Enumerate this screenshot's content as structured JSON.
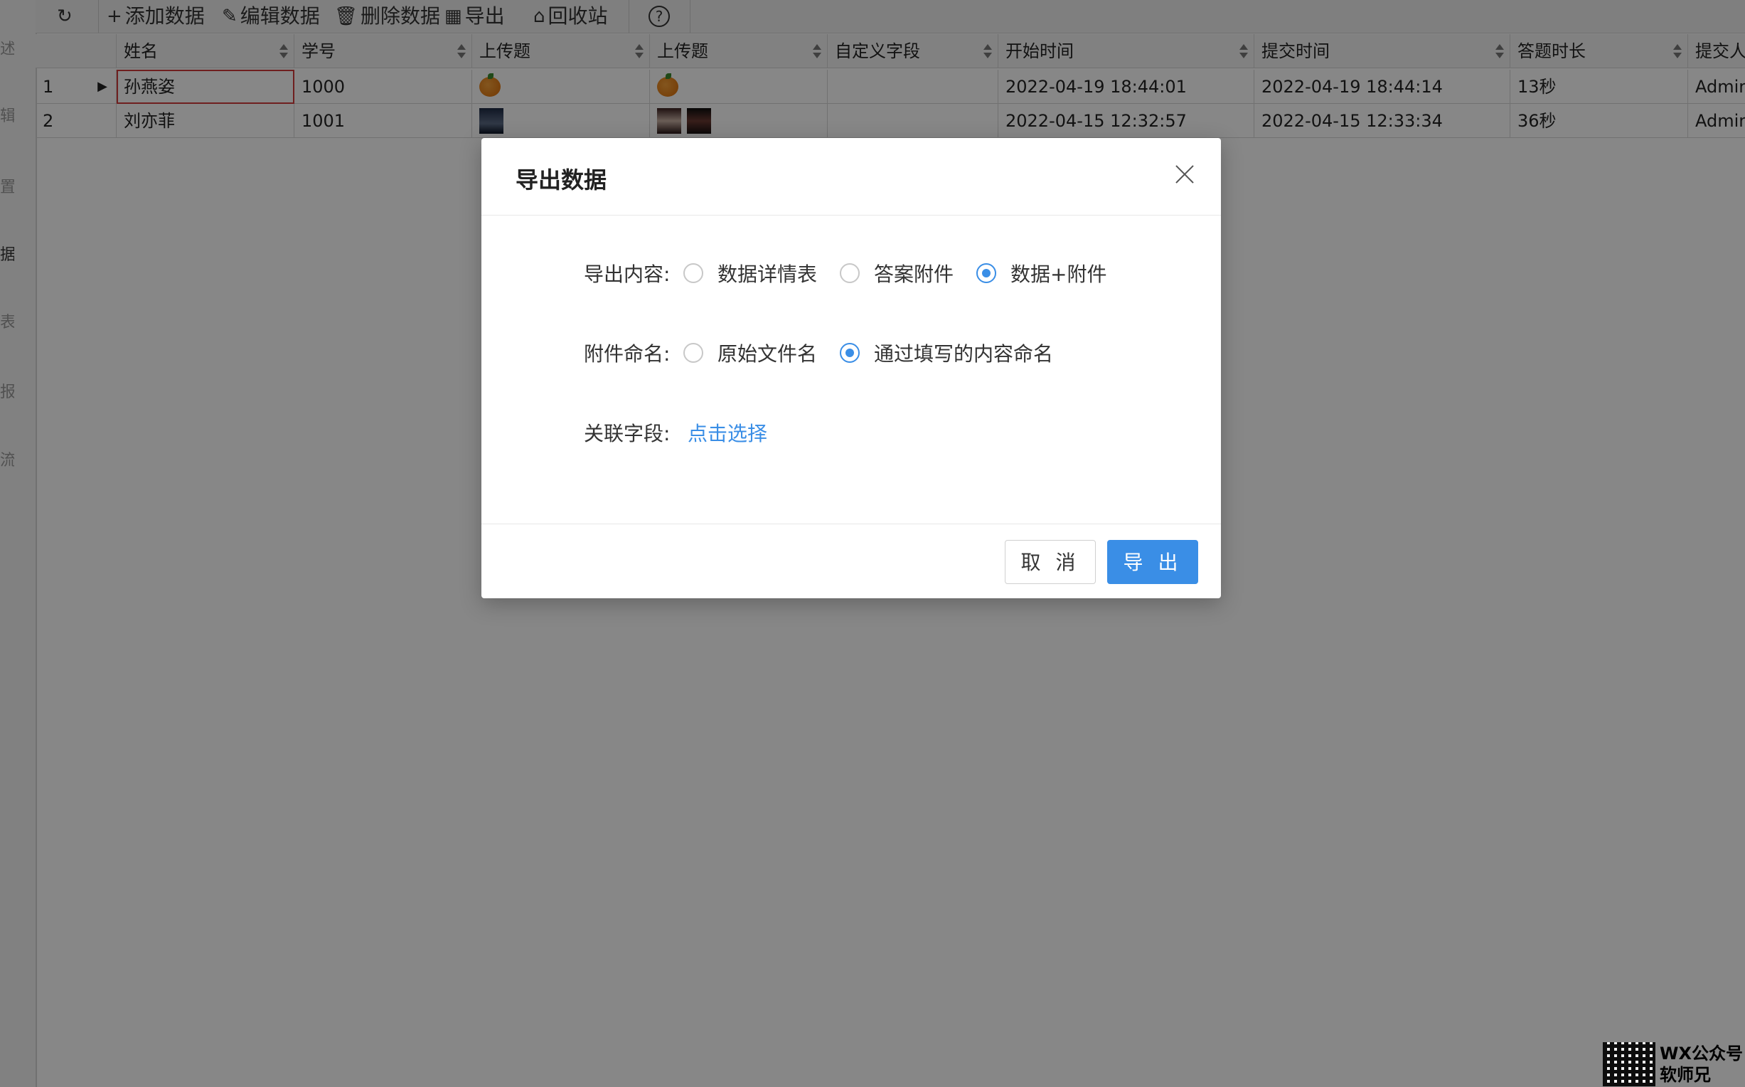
{
  "sidebar": {
    "items": [
      "述",
      "辑",
      "置",
      "据",
      "表",
      "报",
      "流"
    ]
  },
  "toolbar": {
    "refresh_icon": "refresh-icon",
    "add_label": "添加数据",
    "edit_label": "编辑数据",
    "delete_label": "删除数据",
    "export_label": "导出",
    "recycle_label": "回收站",
    "help_label": "?"
  },
  "table": {
    "columns": [
      "姓名",
      "学号",
      "上传题",
      "上传题",
      "自定义字段",
      "开始时间",
      "提交时间",
      "答题时长",
      "提交人"
    ],
    "rows": [
      {
        "index": "1",
        "name": "孙燕姿",
        "id": "1000",
        "start": "2022-04-19 18:44:01",
        "submit": "2022-04-19 18:44:14",
        "duration": "13秒",
        "submitter": "Admin"
      },
      {
        "index": "2",
        "name": "刘亦菲",
        "id": "1001",
        "start": "2022-04-15 12:32:57",
        "submit": "2022-04-15 12:33:34",
        "duration": "36秒",
        "submitter": "Admin"
      }
    ]
  },
  "dialog": {
    "title": "导出数据",
    "export_content": {
      "label": "导出内容:",
      "options": [
        "数据详情表",
        "答案附件",
        "数据+附件"
      ],
      "selected": "数据+附件"
    },
    "naming": {
      "label": "附件命名:",
      "options": [
        "原始文件名",
        "通过填写的内容命名"
      ],
      "selected": "通过填写的内容命名"
    },
    "link_field": {
      "label": "关联字段:",
      "link_text": "点击选择"
    },
    "cancel_label": "取 消",
    "export_label": "导 出"
  },
  "watermark": {
    "line1": "WX公众号",
    "line2": "软师兄"
  },
  "colors": {
    "accent": "#3a8ee6",
    "overlay": "rgba(0,0,0,0.47)",
    "selected_cell_border": "#d23b3b"
  }
}
